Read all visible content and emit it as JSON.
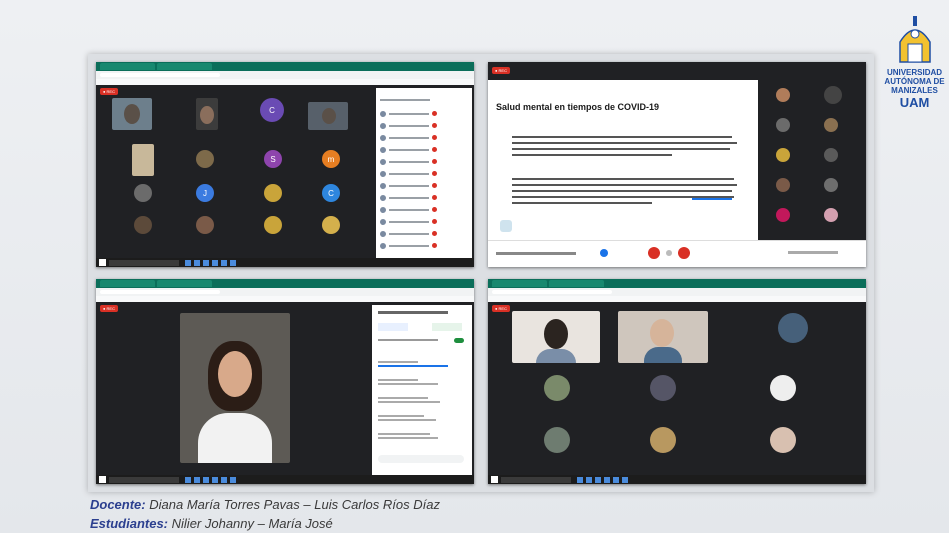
{
  "slide": {
    "title": "Salud mental en tiempos de COVID-19"
  },
  "logo": {
    "line1": "UNIVERSIDAD",
    "line2": "AUTÓNOMA DE",
    "line3": "MANIZALES",
    "abbr": "UAM"
  },
  "caption": {
    "docente_label": "Docente:",
    "docente_names": "Diana María Torres Pavas – Luis Carlos Ríos Díaz",
    "estudiantes_label": "Estudiantes:",
    "estudiantes_names": "Nilier Johanny – María José"
  },
  "avatars": {
    "c1": "C",
    "s1": "S",
    "m1": "m",
    "j1": "J",
    "c2": "C"
  },
  "colors": {
    "accent": "#2b3f8f",
    "record": "#d93025",
    "meet_bg": "#202124",
    "browser_bar": "#0b6e5a"
  }
}
